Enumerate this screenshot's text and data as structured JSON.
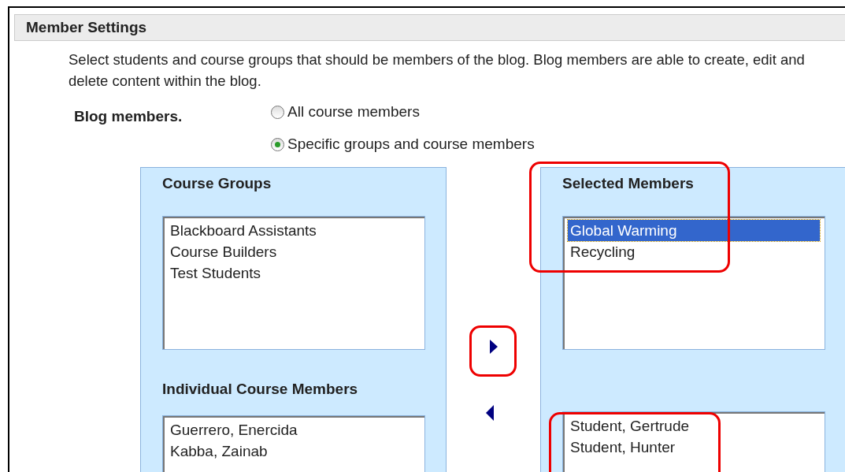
{
  "section": {
    "title": "Member Settings",
    "description": "Select students and course groups that should be members of the blog. Blog members are able to create, edit and delete content within the blog.",
    "field_label": "Blog members.",
    "options": [
      {
        "label": "All course members",
        "selected": false
      },
      {
        "label": "Specific groups and course members",
        "selected": true
      }
    ]
  },
  "available": {
    "groups_title": "Course Groups",
    "groups": [
      {
        "label": "Blackboard Assistants",
        "selected": false
      },
      {
        "label": "Course Builders",
        "selected": false
      },
      {
        "label": "Test Students",
        "selected": false
      }
    ],
    "members_title": "Individual Course Members",
    "members": [
      {
        "label": "Guerrero, Enercida",
        "selected": false
      },
      {
        "label": "Kabba, Zainab",
        "selected": false
      }
    ]
  },
  "selected": {
    "title": "Selected Members",
    "groups": [
      {
        "label": "Global Warming",
        "selected": true
      },
      {
        "label": "Recycling",
        "selected": false
      }
    ],
    "members": [
      {
        "label": "Student, Gertrude",
        "selected": false
      },
      {
        "label": "Student, Hunter",
        "selected": false
      }
    ]
  }
}
